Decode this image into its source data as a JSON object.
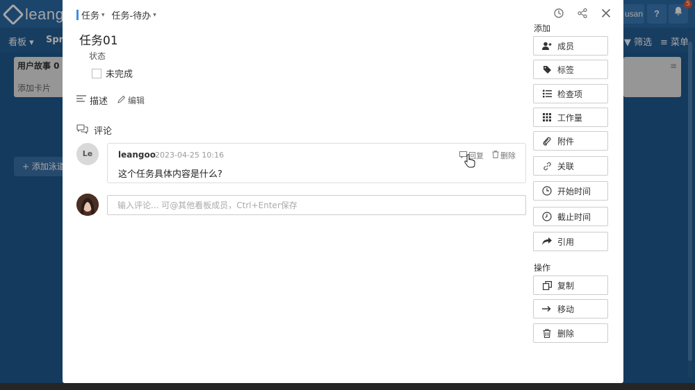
{
  "background": {
    "logo_text": "leang",
    "user_text": "usan",
    "help_label": "?",
    "notification_badge": "5",
    "nav_board": "看板 ▾",
    "nav_sprint": "Spr",
    "nav_filter": "▼ 筛选",
    "nav_menu": "≡ 菜单",
    "lane_title": "用户故事 0",
    "lane_add": "添加卡片",
    "add_lane": "+ 添加泳道"
  },
  "modal": {
    "breadcrumb": {
      "type": "任务",
      "list": "任务-待办"
    },
    "title": "任务01",
    "status_label": "状态",
    "status_value": "未完成",
    "description_label": "描述",
    "edit_label": "编辑",
    "comments_label": "评论",
    "comments": [
      {
        "avatar_initials": "Le",
        "author": "leangoo",
        "time": "2023-04-25 10:16",
        "text": "这个任务具体内容是什么?",
        "reply_label": "回复",
        "delete_label": "删除"
      }
    ],
    "comment_placeholder": "输入评论... 可@其他看板成员，Ctrl+Enter保存"
  },
  "sidebar": {
    "add_label": "添加",
    "add_buttons": [
      {
        "label": "成员",
        "icon": "add-user-icon"
      },
      {
        "label": "标签",
        "icon": "tag-icon"
      },
      {
        "label": "检查项",
        "icon": "checklist-icon"
      },
      {
        "label": "工作量",
        "icon": "grid-icon"
      },
      {
        "label": "附件",
        "icon": "paperclip-icon"
      },
      {
        "label": "关联",
        "icon": "link-icon"
      },
      {
        "label": "开始时间",
        "icon": "clock-icon"
      },
      {
        "label": "截止时间",
        "icon": "clock-icon"
      },
      {
        "label": "引用",
        "icon": "share-icon"
      }
    ],
    "ops_label": "操作",
    "op_buttons": [
      {
        "label": "复制",
        "icon": "copy-icon"
      },
      {
        "label": "移动",
        "icon": "arrow-right-icon"
      },
      {
        "label": "删除",
        "icon": "trash-icon"
      }
    ]
  },
  "colors": {
    "accent": "#3d8ee0",
    "board_bg": "#2b6aa6"
  }
}
